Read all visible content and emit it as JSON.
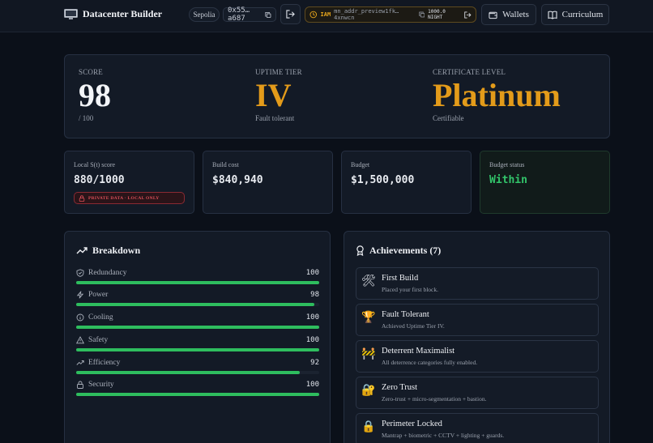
{
  "header": {
    "app_title": "Datacenter Builder",
    "network": "Sepolia",
    "address": "0x55…a687",
    "iam_label": "IAM",
    "iam_address": "mn_addr_preview1fk…4xnwcn",
    "iam_balance": "1000.0 NIGHT",
    "wallets_label": "Wallets",
    "curriculum_label": "Curriculum"
  },
  "score": {
    "label": "SCORE",
    "value": "98",
    "sub": "/ 100"
  },
  "uptime": {
    "label": "UPTIME TIER",
    "value": "IV",
    "sub": "Fault tolerant"
  },
  "certificate": {
    "label": "CERTIFICATE LEVEL",
    "value": "Platinum",
    "sub": "Certifiable"
  },
  "stats": {
    "local_score_label": "Local S(t) score",
    "local_score_value": "880/1000",
    "private_badge": "PRIVATE DATA · LOCAL ONLY",
    "build_cost_label": "Build cost",
    "build_cost_value": "$840,940",
    "budget_label": "Budget",
    "budget_value": "$1,500,000",
    "budget_status_label": "Budget status",
    "budget_status_value": "Within"
  },
  "breakdown": {
    "title": "Breakdown",
    "items": [
      {
        "label": "Redundancy",
        "value": "100",
        "fraction": 1.0,
        "icon": "shield-icon"
      },
      {
        "label": "Power",
        "value": "98",
        "fraction": 0.98,
        "icon": "bolt-icon"
      },
      {
        "label": "Cooling",
        "value": "100",
        "fraction": 1.0,
        "icon": "info-circle-icon"
      },
      {
        "label": "Safety",
        "value": "100",
        "fraction": 1.0,
        "icon": "warning-triangle-icon"
      },
      {
        "label": "Efficiency",
        "value": "92",
        "fraction": 0.92,
        "icon": "trend-up-icon"
      },
      {
        "label": "Security",
        "value": "100",
        "fraction": 1.0,
        "icon": "lock-icon"
      }
    ]
  },
  "achievements": {
    "title": "Achievements (7)",
    "items": [
      {
        "emoji": "🛠",
        "title": "First Build",
        "desc": "Placed your first block."
      },
      {
        "emoji": "🏆",
        "title": "Fault Tolerant",
        "desc": "Achieved Uptime Tier IV."
      },
      {
        "emoji": "🚧",
        "title": "Deterrent Maximalist",
        "desc": "All deterrence categories fully enabled."
      },
      {
        "emoji": "🔐",
        "title": "Zero Trust",
        "desc": "Zero-trust + micro-segmentation + bastion."
      },
      {
        "emoji": "🔒",
        "title": "Perimeter Locked",
        "desc": "Mantrap + biometric + CCTV + lighting + guards."
      }
    ]
  },
  "colors": {
    "accent_gold": "#e39b1a",
    "success_green": "#2ebd5e",
    "danger_red": "#e0505a"
  }
}
